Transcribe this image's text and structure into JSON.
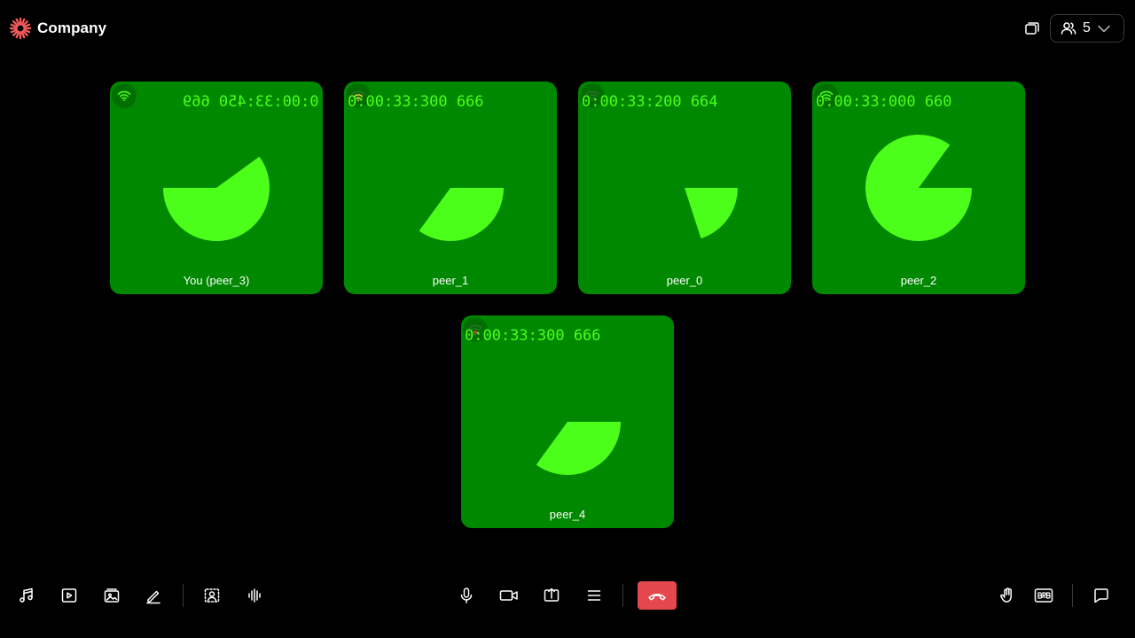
{
  "header": {
    "brand": "Company",
    "participant_count": "5"
  },
  "tiles": [
    {
      "name": "You (peer_3)",
      "timer": "0:00:33:450 669",
      "mirrored": true,
      "signal": "good",
      "pie_fraction": 0.6
    },
    {
      "name": "peer_1",
      "timer": "0:00:33:300 666",
      "mirrored": false,
      "signal": "fair",
      "pie_fraction": 0.35
    },
    {
      "name": "peer_0",
      "timer": "0:00:33:200 664",
      "mirrored": false,
      "signal": "weak",
      "pie_fraction": 0.2
    },
    {
      "name": "peer_2",
      "timer": "0:00:33:000 660",
      "mirrored": false,
      "signal": "good",
      "pie_fraction": 0.85
    },
    {
      "name": "peer_4",
      "timer": "0:00:33:300 666",
      "mirrored": false,
      "signal": "poor",
      "pie_fraction": 0.35
    }
  ],
  "colors": {
    "tile_bg": "#008800",
    "pie": "#4cff1a",
    "timer": "#4cff1a",
    "end_call": "#e5474f",
    "brand_logo": "#f05a5a"
  },
  "toolbar": {
    "left": [
      "music-icon",
      "video-playlist-icon",
      "embed-icon",
      "whiteboard-icon",
      "virtual-background-icon",
      "noise-suppression-icon"
    ],
    "center": [
      "microphone-icon",
      "camera-icon",
      "screen-share-icon",
      "more-menu-icon",
      "end-call-icon"
    ],
    "right": [
      "raise-hand-icon",
      "brb-icon",
      "chat-icon"
    ]
  }
}
